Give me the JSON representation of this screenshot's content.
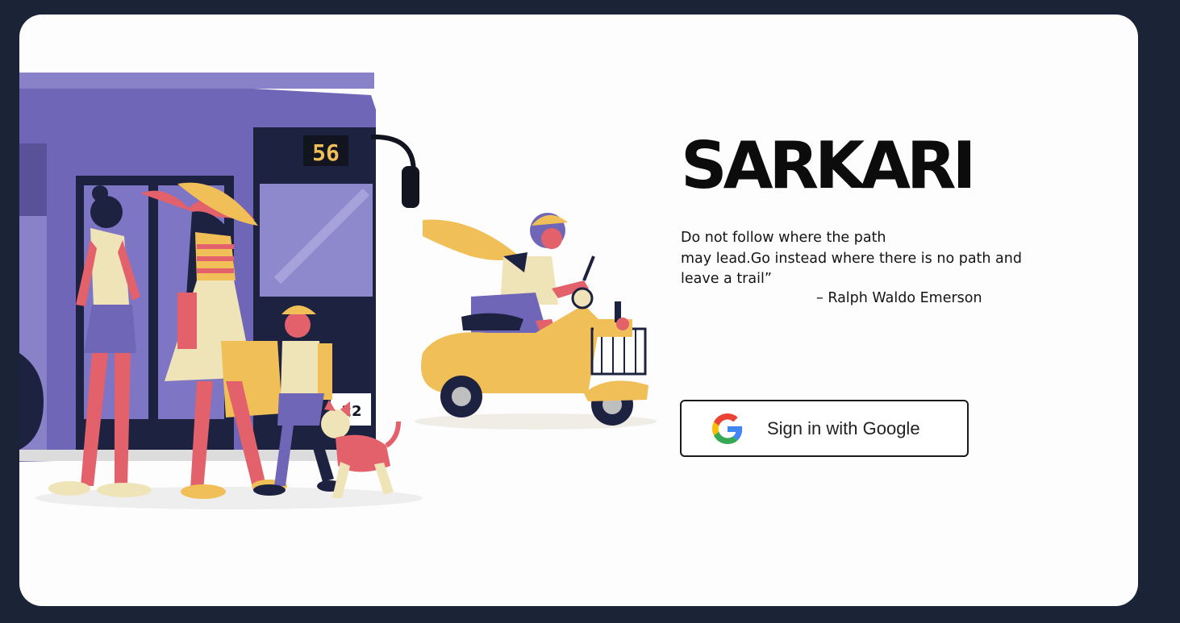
{
  "brand": {
    "name": "SARKARI"
  },
  "quote": {
    "text": "Do not follow where the path\nmay lead.Go instead where there is no path and\nleave a trail”",
    "author": "– Ralph Waldo Emerson"
  },
  "auth": {
    "google_button_label": "Sign in with Google"
  },
  "illustration": {
    "bus_route_number": "56",
    "bus_plate_fragment": "22"
  },
  "colors": {
    "page_bg": "#1b2436",
    "card_bg": "#fdfdfd",
    "bus_purple": "#7066b8",
    "scooter_yellow": "#f1bf58",
    "skin_coral": "#e2616a",
    "dark_navy": "#1d2240"
  }
}
